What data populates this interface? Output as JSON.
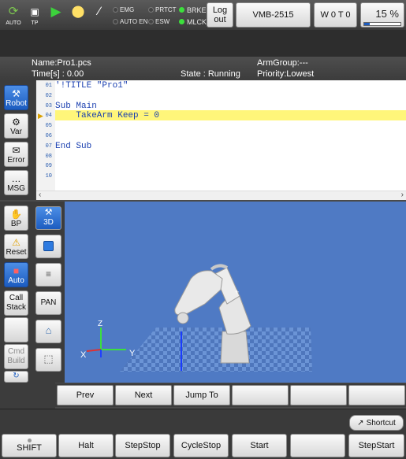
{
  "toolbar": {
    "auto_label": "AUTO",
    "tp_label": "TP",
    "status": {
      "emg": "EMG",
      "auto_en": "AUTO EN",
      "prtct": "PRTCT",
      "esw": "ESW",
      "brke": "BRKE",
      "mlck": "MLCK"
    },
    "logout_label": "Log\nout",
    "controller_label": "VMB-2515",
    "tool_work_label": "W 0 T 0",
    "speed_percent": "15 %",
    "speed_value": 15
  },
  "info": {
    "name": "Name:Pro1.pcs",
    "time": "Time[s] : 0.00",
    "state": "State : Running",
    "armgroup": "ArmGroup:---",
    "priority": "Priority:Lowest"
  },
  "left_tabs": [
    {
      "label": "Robot",
      "icon": "robot-icon"
    },
    {
      "label": "Var",
      "icon": "var-icon"
    },
    {
      "label": "Error",
      "icon": "error-icon"
    },
    {
      "label": "MSG",
      "icon": "message-icon"
    }
  ],
  "left_tools": [
    {
      "label": "BP",
      "icon": "hand-icon"
    },
    {
      "label": "Reset",
      "icon": "warning-icon"
    },
    {
      "label": "Auto",
      "icon": "auto-icon"
    },
    {
      "label": "Call Stack"
    },
    {
      "label": ""
    },
    {
      "label": "Cmd Build"
    }
  ],
  "editor": {
    "line_numbers": [
      "01",
      "02",
      "03",
      "04",
      "05",
      "06",
      "07",
      "08",
      "09",
      "10"
    ],
    "lines": [
      "'!TITLE \"Pro1\"",
      "",
      "Sub Main",
      "    TakeArm Keep = 0",
      "",
      "",
      "End Sub",
      "",
      "",
      ""
    ],
    "current_line": "04"
  },
  "view_tools": [
    {
      "label": "3D",
      "icon": "robot-3d-icon"
    },
    {
      "label": "",
      "icon": "square-icon"
    },
    {
      "label": "",
      "icon": "layers-icon"
    },
    {
      "label": "PAN"
    },
    {
      "label": "",
      "icon": "home-icon"
    },
    {
      "label": "",
      "icon": "cube-icon"
    }
  ],
  "axes": {
    "x": "X",
    "y": "Y",
    "z": "Z"
  },
  "nav": {
    "prev": "Prev",
    "next": "Next",
    "jump": "Jump To"
  },
  "shortcut": "Shortcut",
  "bottom": {
    "shift": "SHIFT",
    "halt": "Halt",
    "stepstop": "StepStop",
    "cyclestop": "CycleStop",
    "start": "Start",
    "stepstart": "StepStart"
  }
}
